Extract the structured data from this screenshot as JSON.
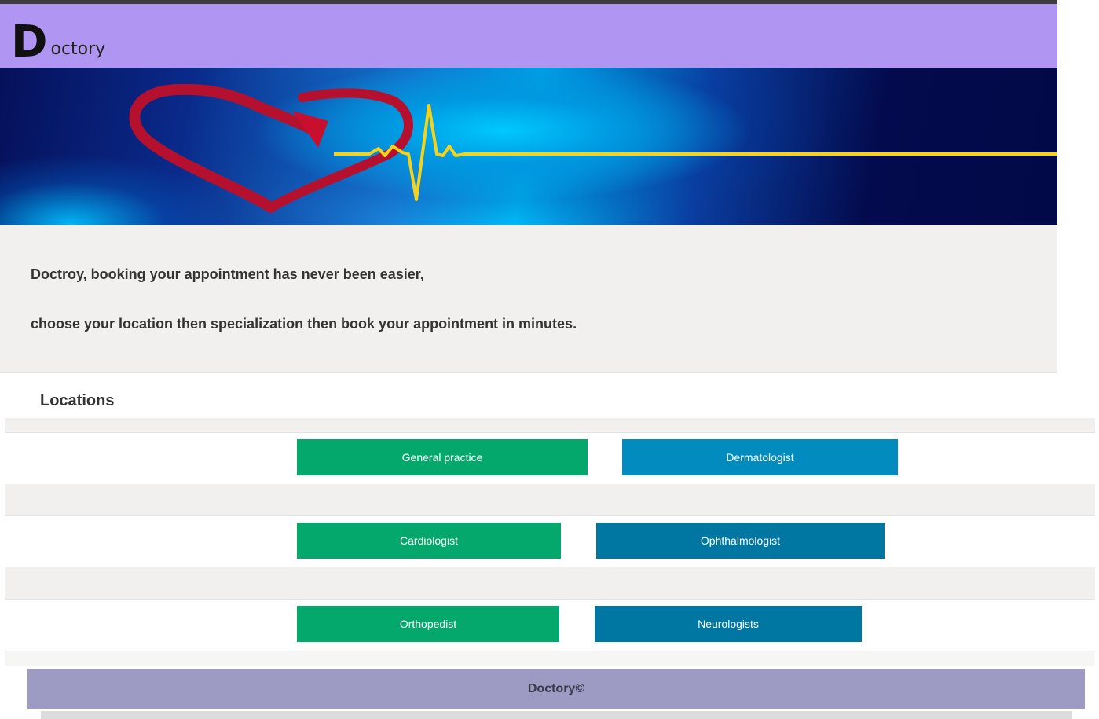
{
  "header": {
    "logo_initial": "D",
    "logo_rest": "octory",
    "background": "#b096f2"
  },
  "banner": {
    "icons": [
      "heart-arrow-icon",
      "heartbeat-line-icon"
    ]
  },
  "intro": {
    "line1": "Doctroy, booking your appointment has never been easier,",
    "line2": "choose your location then specialization then book your appointment in minutes."
  },
  "locations": {
    "title": "Locations",
    "buttons": [
      {
        "label": "General practice",
        "color": "#05a86c"
      },
      {
        "label": "Dermatologist",
        "color": "#018bbf"
      },
      {
        "label": "Cardiologist",
        "color": "#05a86c"
      },
      {
        "label": "Ophthalmologist",
        "color": "#0077a3"
      },
      {
        "label": "Orthopedist",
        "color": "#05a86c"
      },
      {
        "label": "Neurologists",
        "color": "#0077a3"
      }
    ]
  },
  "footer": {
    "text": "Doctory©",
    "background": "#9d9bc4"
  }
}
